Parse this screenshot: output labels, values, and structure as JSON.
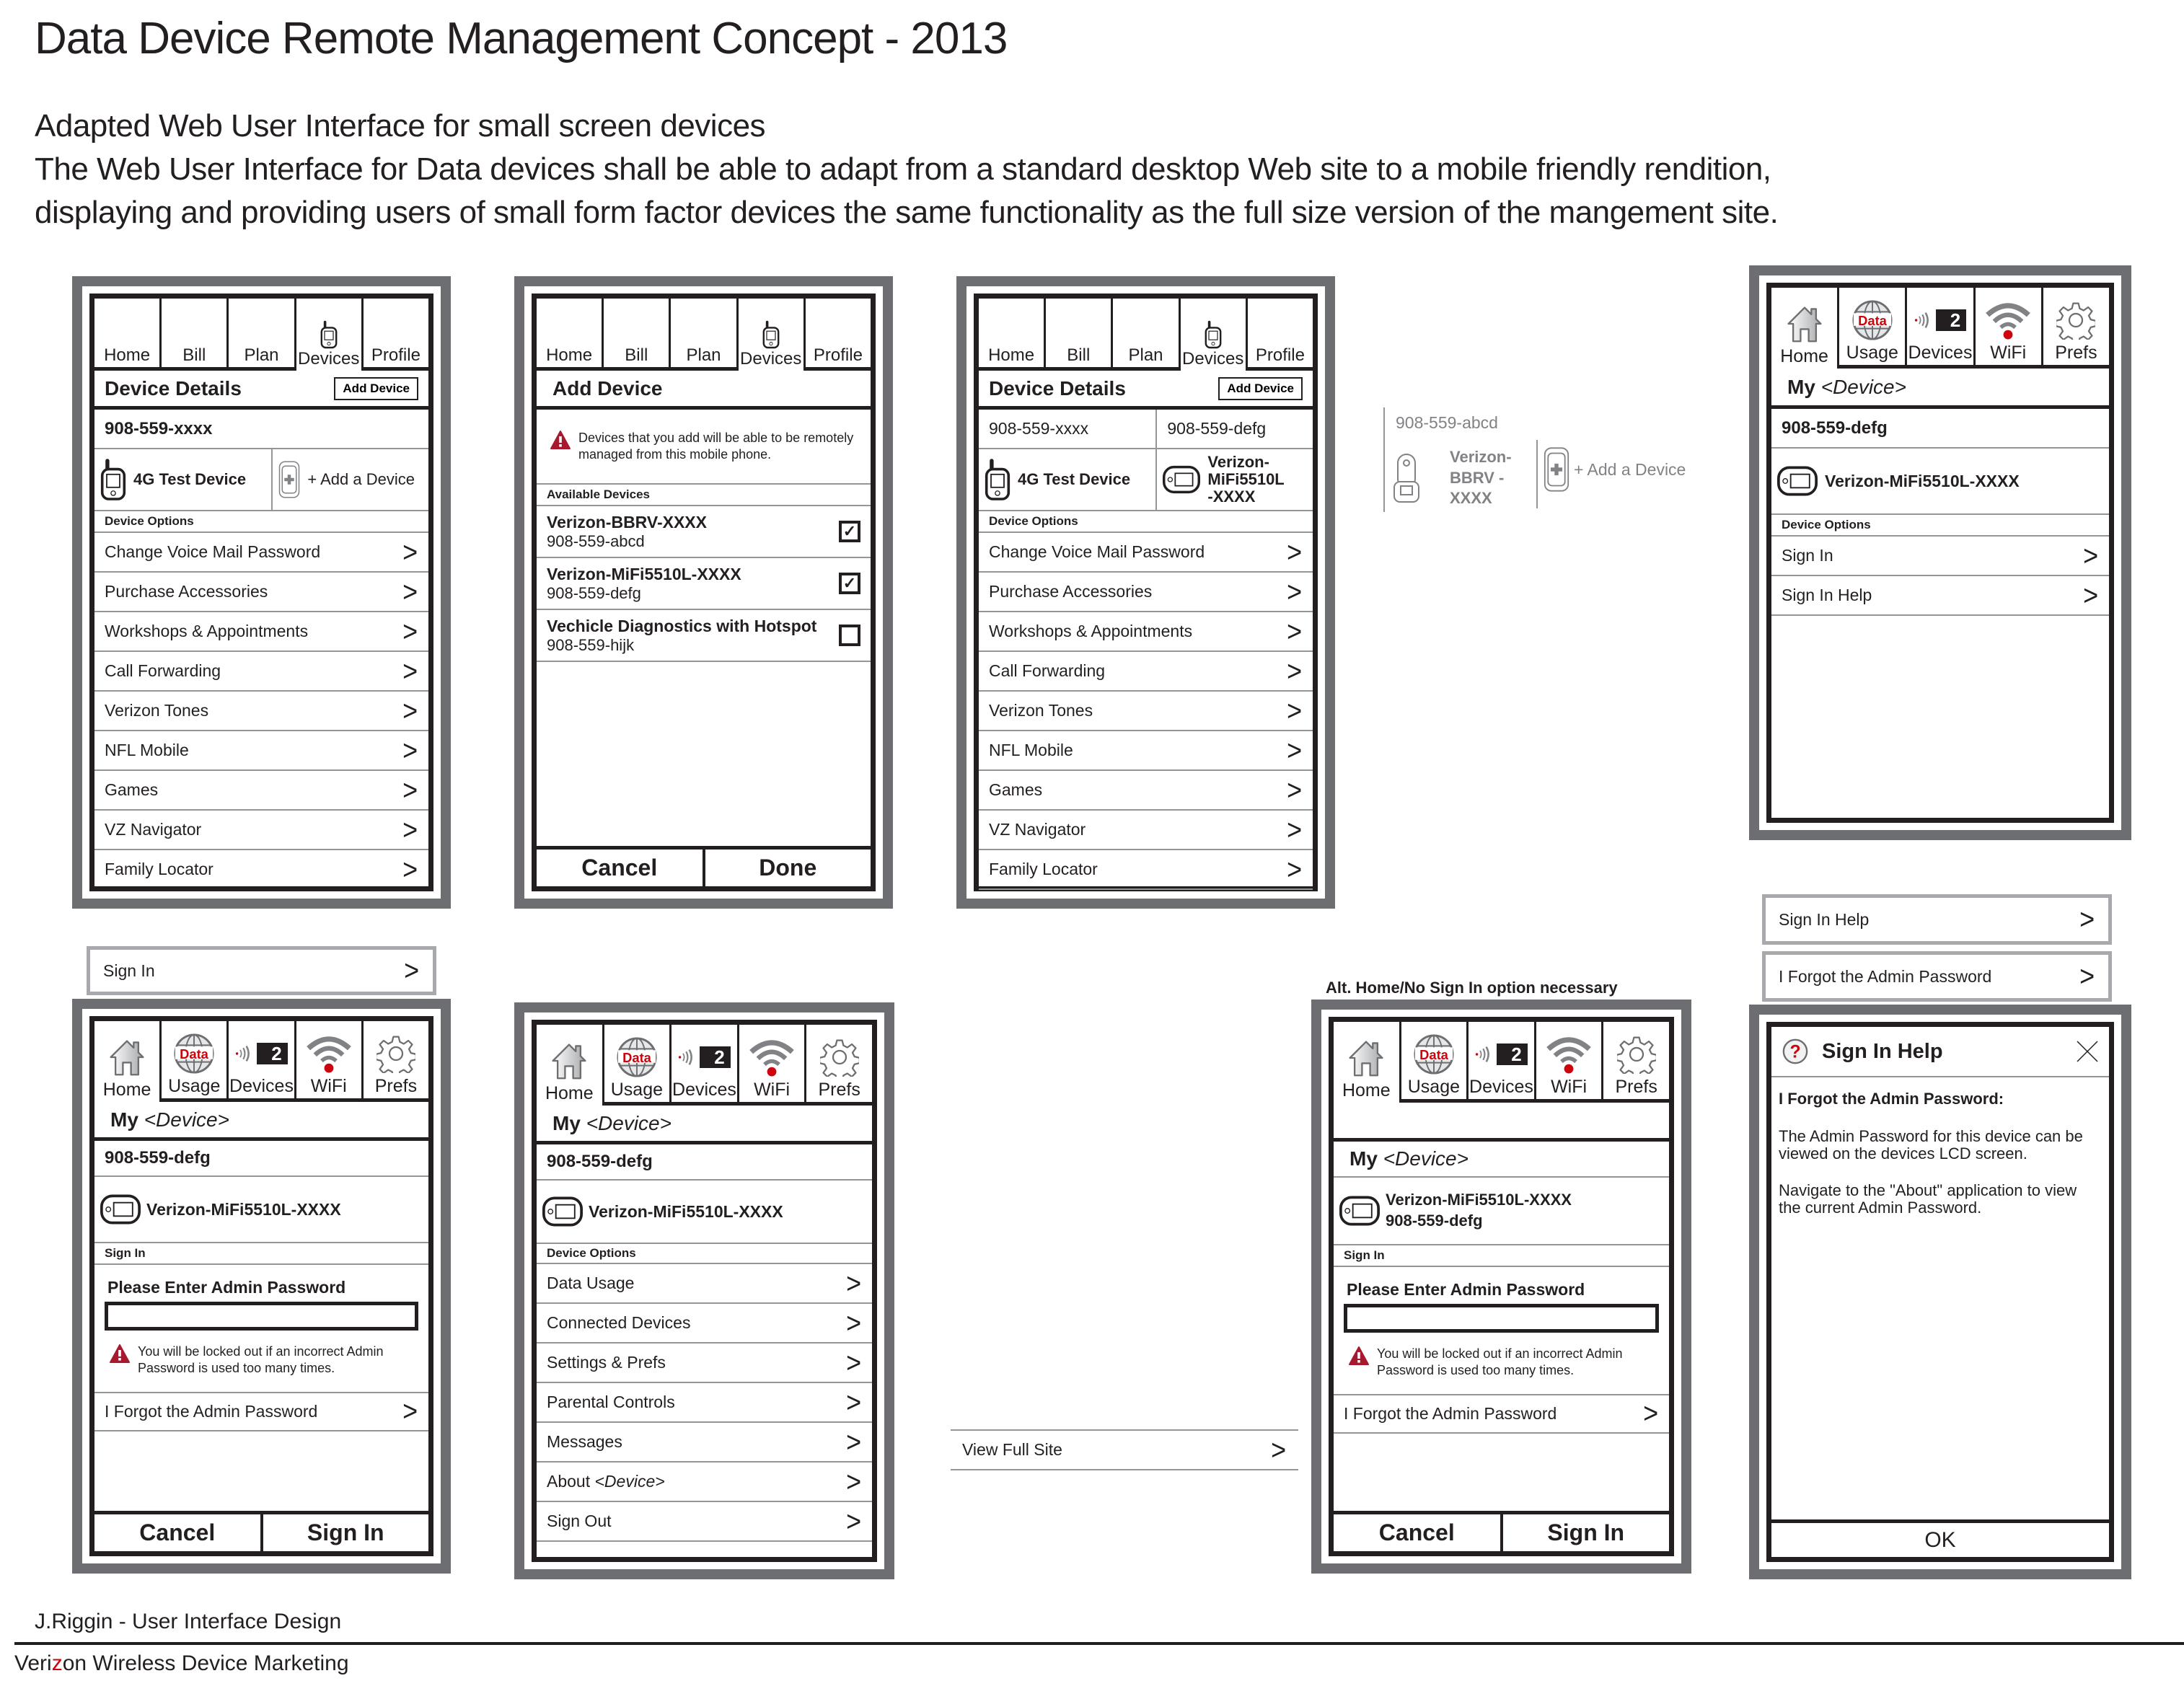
{
  "header": {
    "title": "Data Device Remote Management Concept - 2013",
    "subtitle": "Adapted Web User Interface for small screen devices",
    "description_line1": "The Web User Interface for Data devices shall be able to adapt from a standard desktop Web site to a mobile friendly rendition,",
    "description_line2": "displaying and providing users of small form factor devices the same functionality as the full size version of the mangement site."
  },
  "phone_tabs": [
    "Home",
    "Bill",
    "Plan",
    "Devices",
    "Profile"
  ],
  "device_tabs": [
    "Home",
    "Usage",
    "Devices",
    "WiFi",
    "Prefs"
  ],
  "usage_icon_text": "Data",
  "devices_badge_count": "2",
  "colors": {
    "accent_red": "#cd040b",
    "frame_gray": "#6d6e71",
    "ink": "#231f20",
    "divider": "#939598"
  },
  "phone_details": {
    "title": "Device Details",
    "add_button": "Add Device",
    "number": "908-559-xxxx",
    "device_name": "4G Test Device",
    "add_device_label": "+ Add a Device",
    "section_label": "Device Options",
    "options": [
      "Change Voice Mail Password",
      "Purchase Accessories",
      "Workshops & Appointments",
      "Call Forwarding",
      "Verizon Tones",
      "NFL Mobile",
      "Games",
      "VZ Navigator",
      "Family Locator"
    ]
  },
  "phone_add": {
    "title": "Add Device",
    "warning": "Devices that you add will be able to be remotely managed from this mobile phone.",
    "section_label": "Available Devices",
    "devices": [
      {
        "name": "Verizon-BBRV-XXXX",
        "number": "908-559-abcd",
        "checked": true
      },
      {
        "name": "Verizon-MiFi5510L-XXXX",
        "number": "908-559-defg",
        "checked": true
      },
      {
        "name": "Vechicle Diagnostics with Hotspot",
        "number": "908-559-hijk",
        "checked": false
      }
    ],
    "cancel": "Cancel",
    "done": "Done"
  },
  "phone_details_multi": {
    "title": "Device Details",
    "add_button": "Add Device",
    "numbers": [
      "908-559-xxxx",
      "908-559-defg",
      "908-559-abcd"
    ],
    "devices": [
      "4G Test Device",
      "Verizon-MiFi5510L -XXXX",
      "Verizon-BBRV -XXXX"
    ],
    "add_device_label": "+ Add a Device",
    "section_label": "Device Options",
    "options": [
      "Change Voice Mail Password",
      "Purchase Accessories",
      "Workshops & Appointments",
      "Call Forwarding",
      "Verizon Tones",
      "NFL Mobile",
      "Games",
      "VZ Navigator",
      "Family Locator"
    ]
  },
  "my_device": {
    "my": "My",
    "placeholder": "<Device>"
  },
  "phone_home": {
    "number": "908-559-defg",
    "device_name": "Verizon-MiFi5510L-XXXX",
    "section_label": "Device Options",
    "options": [
      "Sign In",
      "Sign In Help"
    ]
  },
  "signin_bar": "Sign In",
  "phone_signin": {
    "number": "908-559-defg",
    "device_name": "Verizon-MiFi5510L-XXXX",
    "section_label": "Sign In",
    "prompt": "Please Enter Admin Password",
    "password_value": "",
    "warning": "You will be locked out if an incorrect Admin Password is used too many times.",
    "forgot": "I Forgot the Admin Password",
    "cancel": "Cancel",
    "sign_in": "Sign In"
  },
  "phone_options": {
    "number": "908-559-defg",
    "device_name": "Verizon-MiFi5510L-XXXX",
    "section_label": "Device Options",
    "options": [
      "Data Usage",
      "Connected Devices",
      "Settings & Prefs",
      "Parental Controls",
      "Messages",
      "About",
      "Sign Out"
    ],
    "about_suffix": "<Device>"
  },
  "view_full_site": "View Full Site",
  "alt_label": "Alt. Home/No Sign In option necessary",
  "phone_alt": {
    "device_name": "Verizon-MiFi5510L-XXXX",
    "number": "908-559-defg",
    "section_label": "Sign In",
    "prompt": "Please Enter Admin Password",
    "warning": "You will be locked out if an incorrect Admin Password is used too many times.",
    "forgot": "I Forgot the Admin Password",
    "cancel": "Cancel",
    "sign_in": "Sign In"
  },
  "signin_help_bar": "Sign In Help",
  "forgot_bar": "I Forgot the Admin Password",
  "dialog": {
    "title": "Sign In Help",
    "heading": "I Forgot the Admin Password:",
    "para1": "The Admin Password for this device can be viewed on the devices LCD screen.",
    "para2": "Navigate to the \"About\" application to view the current Admin Password.",
    "ok": "OK"
  },
  "footer": {
    "credit": "J.Riggin - User Interface Design",
    "org_pre": "Veri",
    "org_z": "z",
    "org_post": "on Wireless Device Marketing"
  }
}
